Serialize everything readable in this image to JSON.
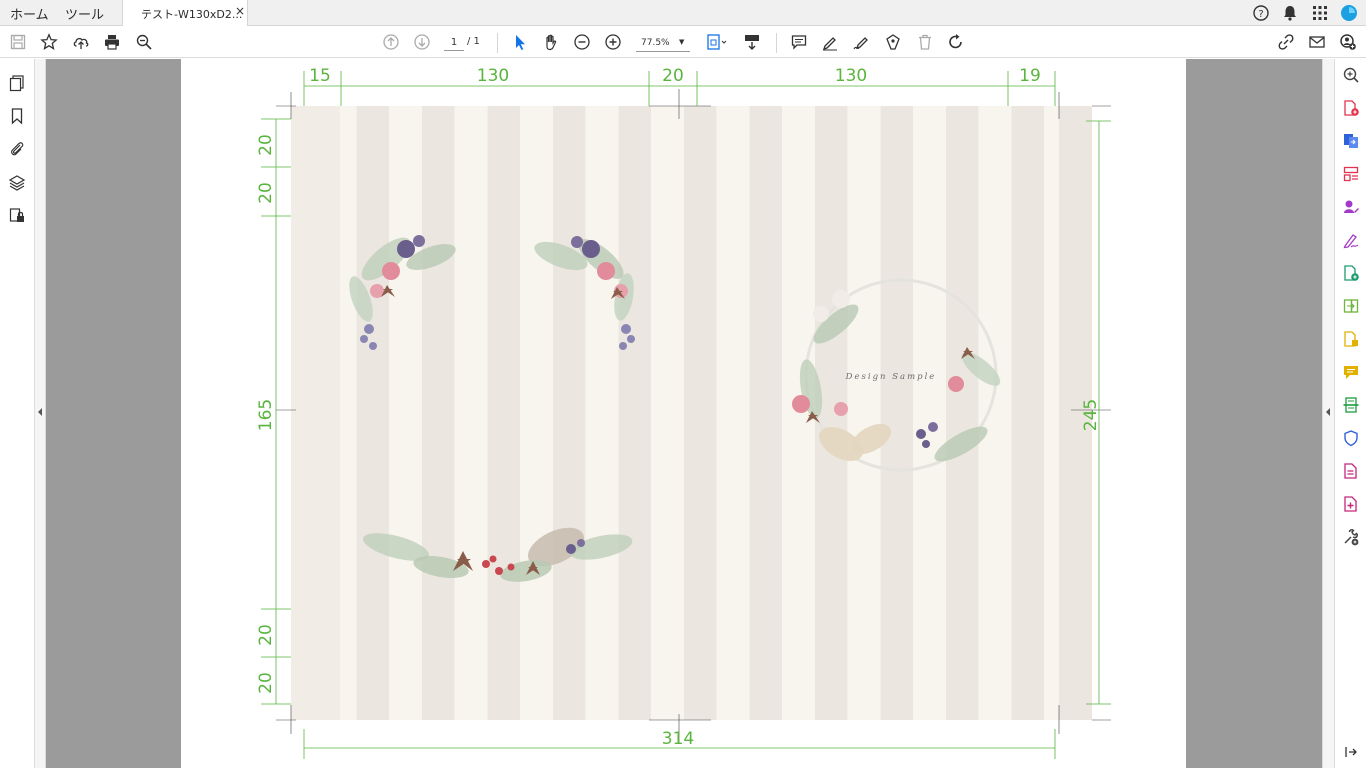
{
  "tabs": {
    "home": "ホーム",
    "tools": "ツール",
    "document": "テスト-W130xD2...",
    "close": "×"
  },
  "toolbar": {
    "page_current": "1",
    "page_total": "/ 1",
    "zoom": "77.5%",
    "zoom_arrow": "▼"
  },
  "document": {
    "dimensions": {
      "top_left_margin": "15",
      "top_left_width": "130",
      "top_gap": "20",
      "top_right_width": "130",
      "top_right_margin": "19",
      "left_top_1": "20",
      "left_top_2": "20",
      "left_height": "165",
      "left_bottom_1": "20",
      "left_bottom_2": "20",
      "right_height": "245",
      "bottom_width": "314"
    },
    "wreath_text": "Design Sample"
  },
  "colors": {
    "dimension_green": "#5ab53e",
    "stripe_dark": "#ebe6e0",
    "stripe_light": "#f8f5ef",
    "accent_blue": "#1473e6"
  },
  "icons": {
    "header": [
      "help-icon",
      "bell-icon",
      "apps-grid-icon",
      "avatar"
    ],
    "toolbar_left": [
      "save-icon",
      "star-icon",
      "upload-icon",
      "print-icon",
      "zoom-search-icon"
    ],
    "right_panel": [
      "zoom-icon",
      "export-pdf-icon",
      "create-pdf-icon",
      "organize-pages-icon",
      "edit-pdf-icon",
      "fill-sign-icon",
      "request-signature-icon",
      "combine-files-icon",
      "compare-icon",
      "comment-icon",
      "scan-icon",
      "protect-icon",
      "pdf-standards-icon",
      "rich-media-icon",
      "more-tools-icon"
    ]
  }
}
